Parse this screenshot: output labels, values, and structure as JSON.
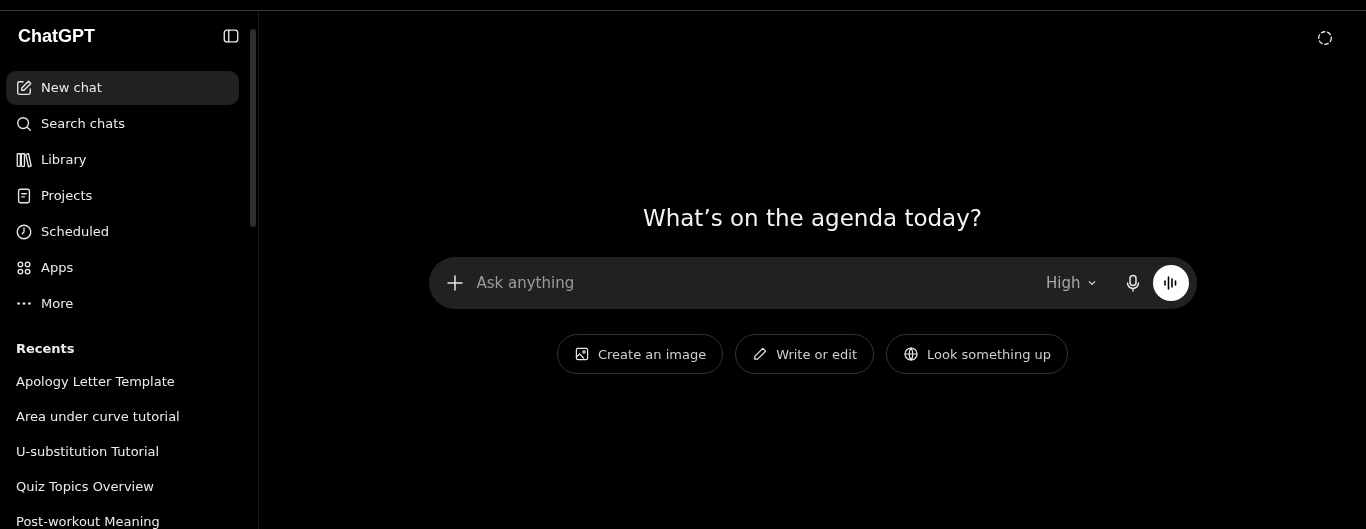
{
  "sidebar": {
    "title": "ChatGPT",
    "items": [
      {
        "label": "New chat",
        "selected": true
      },
      {
        "label": "Search chats",
        "selected": false
      },
      {
        "label": "Library",
        "selected": false
      },
      {
        "label": "Projects",
        "selected": false
      },
      {
        "label": "Scheduled",
        "selected": false
      },
      {
        "label": "Apps",
        "selected": false
      },
      {
        "label": "More",
        "selected": false
      }
    ],
    "recents_heading": "Recents",
    "recents": [
      "Apology Letter Template",
      "Area under curve tutorial",
      "U-substitution Tutorial",
      "Quiz Topics Overview",
      "Post-workout Meaning"
    ]
  },
  "main": {
    "heading": "What’s on the agenda today?",
    "composer": {
      "placeholder": "Ask anything",
      "model": "High"
    },
    "suggestions": [
      "Create an image",
      "Write or edit",
      "Look something up"
    ]
  }
}
